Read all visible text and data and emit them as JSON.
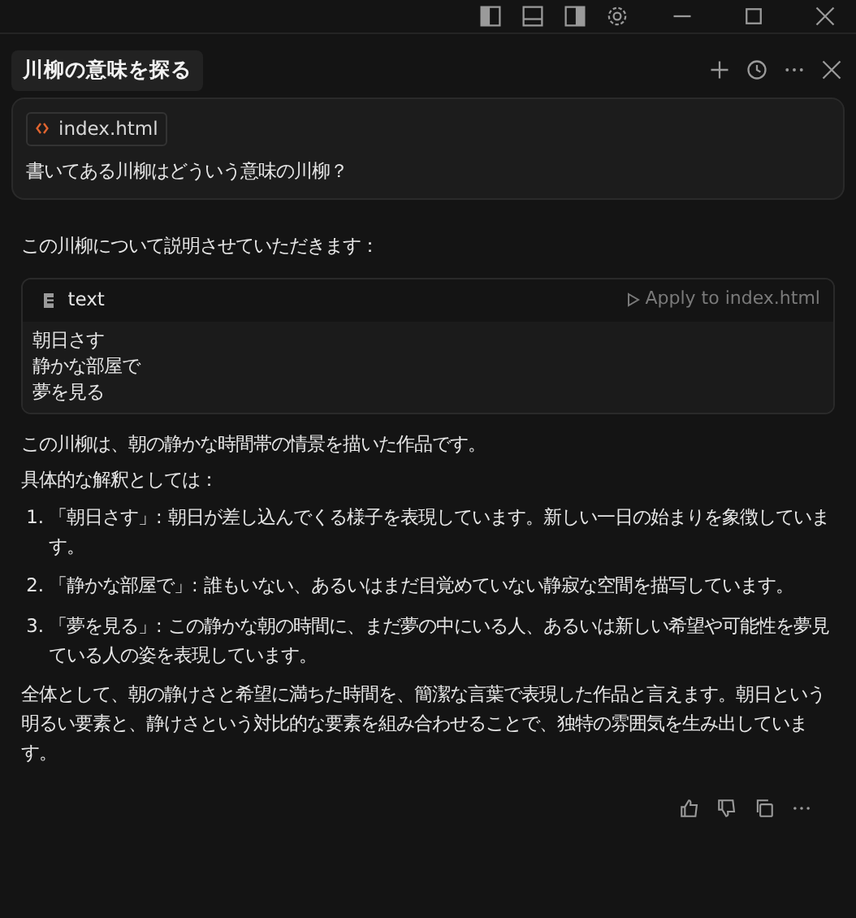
{
  "chat": {
    "title": "川柳の意味を探る"
  },
  "user_message": {
    "attachment": "index.html",
    "text": "書いてある川柳はどういう意味の川柳？"
  },
  "reply": {
    "intro": "この川柳について説明させていただきます：",
    "code_block": {
      "language": "text",
      "action": "Apply to index.html",
      "lines": [
        "朝日さす",
        "静かな部屋で",
        "夢を見る"
      ]
    },
    "paragraphs": [
      "この川柳は、朝の静かな時間帯の情景を描いた作品です。",
      "具体的な解釈としては："
    ],
    "list": [
      {
        "number": "1.",
        "text": "「朝日さす」: 朝日が差し込んでくる様子を表現しています。新しい一日の始まりを象徴しています。"
      },
      {
        "number": "2.",
        "text": "「静かな部屋で」: 誰もいない、あるいはまだ目覚めていない静寂な空間を描写しています。"
      },
      {
        "number": "3.",
        "text": "「夢を見る」: この静かな朝の時間に、まだ夢の中にいる人、あるいは新しい希望や可能性を夢見ている人の姿を表現しています。"
      }
    ],
    "conclusion": "全体として、朝の静けさと希望に満ちた時間を、簡潔な言葉で表現した作品と言えます。朝日という明るい要素と、静けさという対比的な要素を組み合わせることで、独特の雰囲気を生み出しています。"
  }
}
